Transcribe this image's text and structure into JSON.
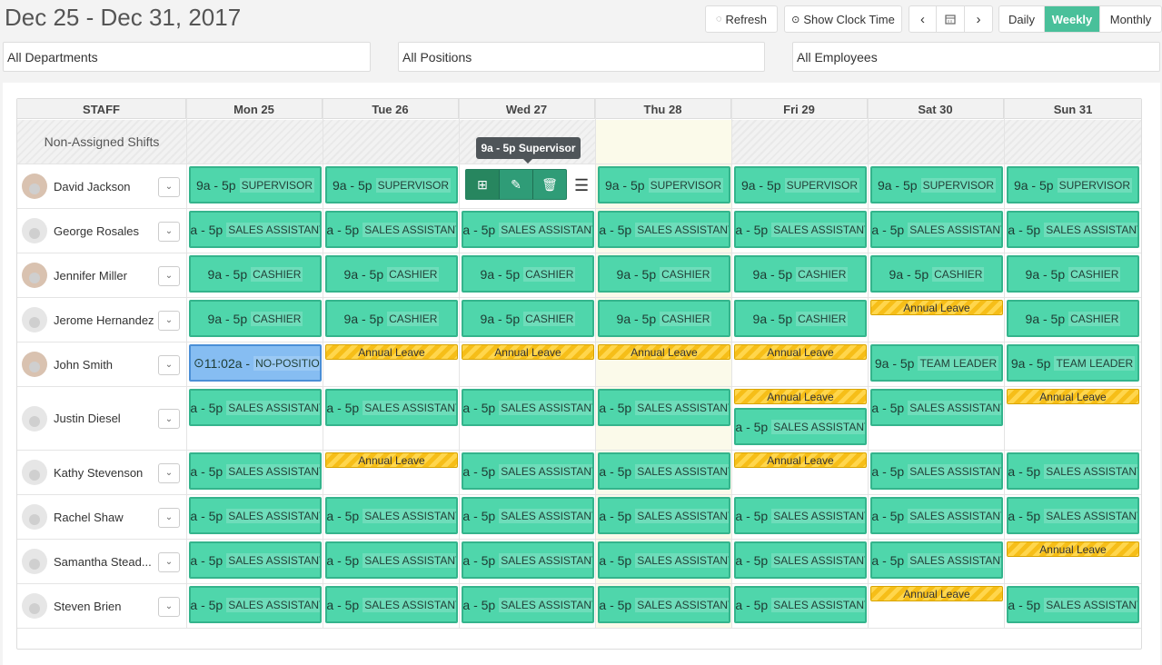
{
  "header": {
    "date_range": "Dec 25 - Dec 31, 2017",
    "refresh_label": "Refresh",
    "clock_label": "Show Clock Time",
    "views": {
      "daily": "Daily",
      "weekly": "Weekly",
      "monthly": "Monthly"
    },
    "active_view": "Weekly"
  },
  "filters": {
    "departments": "All Departments",
    "positions": "All Positions",
    "employees": "All Employees"
  },
  "grid": {
    "staff_header": "STAFF",
    "days": [
      "Mon 25",
      "Tue 26",
      "Wed 27",
      "Thu 28",
      "Fri 29",
      "Sat 30",
      "Sun 31"
    ],
    "non_assigned_label": "Non-Assigned Shifts",
    "tooltip": "9a - 5p Supervisor",
    "shift_time": "9a - 5p",
    "leave_label": "Annual Leave",
    "noposition": {
      "time": "11:02a -",
      "pos": "NO-POSITION"
    },
    "staff": [
      {
        "name": "David Jackson",
        "avatar": "photo",
        "shifts": [
          "SUPERVISOR",
          "SUPERVISOR",
          "SUPERVISOR",
          "SUPERVISOR",
          "SUPERVISOR",
          "SUPERVISOR",
          "SUPERVISOR"
        ]
      },
      {
        "name": "George Rosales",
        "avatar": "placeholder",
        "shifts": [
          "SALES ASSISTANT",
          "SALES ASSISTANT",
          "SALES ASSISTANT",
          "SALES ASSISTANT",
          "SALES ASSISTANT",
          "SALES ASSISTANT",
          "SALES ASSISTANT"
        ]
      },
      {
        "name": "Jennifer Miller",
        "avatar": "photo",
        "shifts": [
          "CASHIER",
          "CASHIER",
          "CASHIER",
          "CASHIER",
          "CASHIER",
          "CASHIER",
          "CASHIER"
        ]
      },
      {
        "name": "Jerome Hernandez",
        "avatar": "placeholder",
        "shifts": [
          "CASHIER",
          "CASHIER",
          "CASHIER",
          "CASHIER",
          "CASHIER",
          "LEAVE",
          "CASHIER"
        ]
      },
      {
        "name": "John Smith",
        "avatar": "photo",
        "shifts": [
          "NOPOS",
          "LEAVE",
          "LEAVE",
          "LEAVE",
          "LEAVE",
          "TEAM LEADER",
          "TEAM LEADER"
        ]
      },
      {
        "name": "Justin Diesel",
        "avatar": "placeholder",
        "shifts": [
          "SALES ASSISTANT",
          "SALES ASSISTANT",
          "SALES ASSISTANT",
          "SALES ASSISTANT",
          "LEAVE+SALES ASSISTANT",
          "SALES ASSISTANT",
          "LEAVE"
        ]
      },
      {
        "name": "Kathy Stevenson",
        "avatar": "placeholder",
        "shifts": [
          "SALES ASSISTANT",
          "LEAVE",
          "SALES ASSISTANT",
          "SALES ASSISTANT",
          "LEAVE",
          "SALES ASSISTANT",
          "SALES ASSISTANT"
        ]
      },
      {
        "name": "Rachel Shaw",
        "avatar": "placeholder",
        "shifts": [
          "SALES ASSISTANT",
          "SALES ASSISTANT",
          "SALES ASSISTANT",
          "SALES ASSISTANT",
          "SALES ASSISTANT",
          "SALES ASSISTANT",
          "SALES ASSISTANT"
        ]
      },
      {
        "name": "Samantha Stead...",
        "avatar": "placeholder",
        "shifts": [
          "SALES ASSISTANT",
          "SALES ASSISTANT",
          "SALES ASSISTANT",
          "SALES ASSISTANT",
          "SALES ASSISTANT",
          "SALES ASSISTANT",
          "LEAVE"
        ]
      },
      {
        "name": "Steven Brien",
        "avatar": "placeholder",
        "shifts": [
          "SALES ASSISTANT",
          "SALES ASSISTANT",
          "SALES ASSISTANT",
          "SALES ASSISTANT",
          "SALES ASSISTANT",
          "LEAVE",
          "SALES ASSISTANT"
        ]
      }
    ]
  },
  "colors": {
    "accent": "#49c09a",
    "shift": "#4fd6ab",
    "shift_border": "#34b48c",
    "leave": "#ffd64c",
    "today_bg": "#fbfaea",
    "noposition": "#86bdf2"
  }
}
